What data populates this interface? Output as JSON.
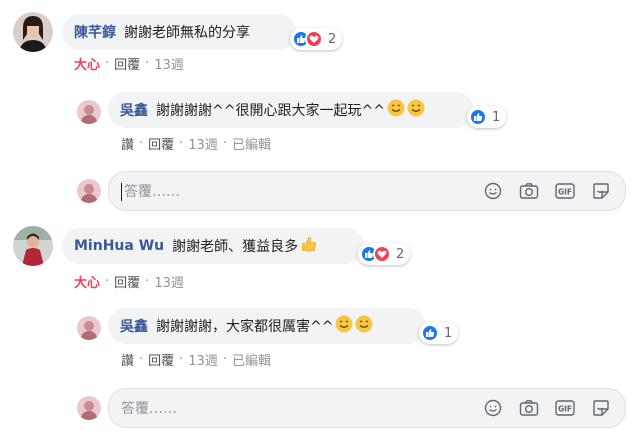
{
  "comments": [
    {
      "author": "陳芊錞",
      "text": "謝謝老師無私的分享",
      "reaction_count": "2",
      "actions": {
        "react": "大心",
        "reply": "回覆",
        "time": "13週"
      },
      "reply": {
        "author": "吳鑫",
        "text": "謝謝謝謝^^很開心跟大家一起玩^^",
        "reaction_count": "1",
        "actions": {
          "like": "讚",
          "reply": "回覆",
          "time": "13週",
          "edited": "已編輯"
        }
      },
      "reply_box": {
        "placeholder": "答覆……"
      }
    },
    {
      "author": "MinHua Wu",
      "text": "謝謝老師、獲益良多",
      "reaction_count": "2",
      "actions": {
        "react": "大心",
        "reply": "回覆",
        "time": "13週"
      },
      "reply": {
        "author": "吳鑫",
        "text": "謝謝謝謝，大家都很厲害^^",
        "reaction_count": "1",
        "actions": {
          "like": "讚",
          "reply": "回覆",
          "time": "13週",
          "edited": "已編輯"
        }
      },
      "reply_box": {
        "placeholder": "答覆……"
      }
    }
  ],
  "separator": "·",
  "input_icons": [
    "emoji-icon",
    "camera-icon",
    "gif-icon",
    "sticker-icon"
  ],
  "colors": {
    "author": "#385898",
    "love": "#f33e58",
    "like": "#1877f2",
    "bubble": "#f2f3f5"
  }
}
